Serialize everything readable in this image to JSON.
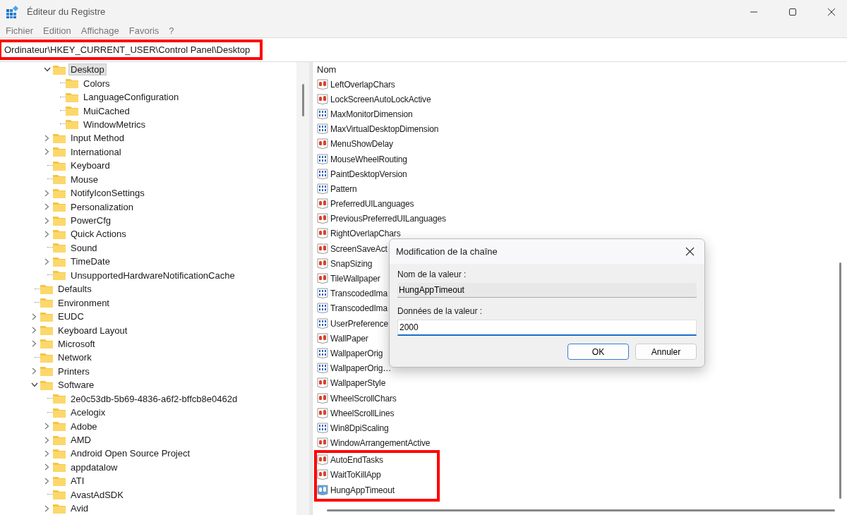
{
  "window": {
    "title": "Éditeur du Registre"
  },
  "menu": [
    "Fichier",
    "Edition",
    "Affichage",
    "Favoris",
    "?"
  ],
  "address_bar": {
    "path": "Ordinateur\\HKEY_CURRENT_USER\\Control Panel\\Desktop",
    "highlighted": true
  },
  "tree": {
    "continued_items": [
      {
        "label": "Desktop",
        "expandable": true,
        "expanded": true,
        "selected": true,
        "children": [
          {
            "label": "Colors",
            "expandable": false,
            "selected": false
          },
          {
            "label": "LanguageConfiguration",
            "expandable": false,
            "selected": false
          },
          {
            "label": "MuiCached",
            "expandable": false,
            "selected": false
          },
          {
            "label": "WindowMetrics",
            "expandable": false,
            "selected": false
          }
        ]
      },
      {
        "label": "Input Method",
        "expandable": true,
        "expanded": false,
        "selected": false
      },
      {
        "label": "International",
        "expandable": true,
        "expanded": false,
        "selected": false
      },
      {
        "label": "Keyboard",
        "expandable": false,
        "selected": false
      },
      {
        "label": "Mouse",
        "expandable": false,
        "selected": false
      },
      {
        "label": "NotifyIconSettings",
        "expandable": true,
        "expanded": false,
        "selected": false
      },
      {
        "label": "Personalization",
        "expandable": true,
        "expanded": false,
        "selected": false
      },
      {
        "label": "PowerCfg",
        "expandable": true,
        "expanded": false,
        "selected": false
      },
      {
        "label": "Quick Actions",
        "expandable": true,
        "expanded": false,
        "selected": false
      },
      {
        "label": "Sound",
        "expandable": false,
        "selected": false
      },
      {
        "label": "TimeDate",
        "expandable": true,
        "expanded": false,
        "selected": false
      },
      {
        "label": "UnsupportedHardwareNotificationCache",
        "expandable": false,
        "selected": false
      }
    ],
    "items": [
      {
        "label": "Defaults",
        "expandable": false,
        "selected": false
      },
      {
        "label": "Environment",
        "expandable": false,
        "selected": false
      },
      {
        "label": "EUDC",
        "expandable": true,
        "expanded": false,
        "selected": false
      },
      {
        "label": "Keyboard Layout",
        "expandable": true,
        "expanded": false,
        "selected": false
      },
      {
        "label": "Microsoft",
        "expandable": true,
        "expanded": false,
        "selected": false
      },
      {
        "label": "Network",
        "expandable": false,
        "selected": false
      },
      {
        "label": "Printers",
        "expandable": true,
        "expanded": false,
        "selected": false
      },
      {
        "label": "Software",
        "expandable": true,
        "expanded": true,
        "selected": false,
        "children": [
          {
            "label": "2e0c53db-5b69-4836-a6f2-bffcb8e0462d",
            "expandable": false,
            "selected": false
          },
          {
            "label": "Acelogix",
            "expandable": false,
            "selected": false
          },
          {
            "label": "Adobe",
            "expandable": true,
            "expanded": false,
            "selected": false
          },
          {
            "label": "AMD",
            "expandable": true,
            "expanded": false,
            "selected": false
          },
          {
            "label": "Android Open Source Project",
            "expandable": true,
            "expanded": false,
            "selected": false
          },
          {
            "label": "appdatalow",
            "expandable": true,
            "expanded": false,
            "selected": false
          },
          {
            "label": "ATI",
            "expandable": true,
            "expanded": false,
            "selected": false
          },
          {
            "label": "AvastAdSDK",
            "expandable": false,
            "selected": false
          },
          {
            "label": "Avid",
            "expandable": true,
            "expanded": false,
            "selected": false
          }
        ]
      }
    ]
  },
  "values": {
    "column": "Nom",
    "items": [
      {
        "name": "LeftOverlapChars",
        "kind": "string",
        "selected": false
      },
      {
        "name": "LockScreenAutoLockActive",
        "kind": "string",
        "selected": false
      },
      {
        "name": "MaxMonitorDimension",
        "kind": "dword",
        "selected": false
      },
      {
        "name": "MaxVirtualDesktopDimension",
        "kind": "dword",
        "selected": false
      },
      {
        "name": "MenuShowDelay",
        "kind": "string",
        "selected": false
      },
      {
        "name": "MouseWheelRouting",
        "kind": "dword",
        "selected": false
      },
      {
        "name": "PaintDesktopVersion",
        "kind": "dword",
        "selected": false
      },
      {
        "name": "Pattern",
        "kind": "dword",
        "selected": false
      },
      {
        "name": "PreferredUILanguages",
        "kind": "string",
        "selected": false
      },
      {
        "name": "PreviousPreferredUILanguages",
        "kind": "string",
        "selected": false
      },
      {
        "name": "RightOverlapChars",
        "kind": "string",
        "selected": false
      },
      {
        "name": "ScreenSaveAct",
        "kind": "string",
        "selected": false
      },
      {
        "name": "SnapSizing",
        "kind": "string",
        "selected": false
      },
      {
        "name": "TileWallpaper",
        "kind": "string",
        "selected": false
      },
      {
        "name": "TranscodedIma",
        "kind": "dword",
        "selected": false
      },
      {
        "name": "TranscodedIma",
        "kind": "dword",
        "selected": false
      },
      {
        "name": "UserPreference",
        "kind": "dword",
        "selected": false
      },
      {
        "name": "WallPaper",
        "kind": "string",
        "selected": false
      },
      {
        "name": "WallpaperOrig",
        "kind": "dword",
        "selected": false
      },
      {
        "name": "WallpaperOrig…",
        "kind": "dword",
        "selected": false
      },
      {
        "name": "WallpaperStyle",
        "kind": "string",
        "selected": false
      },
      {
        "name": "WheelScrollChars",
        "kind": "string",
        "selected": false
      },
      {
        "name": "WheelScrollLines",
        "kind": "string",
        "selected": false
      },
      {
        "name": "Win8DpiScaling",
        "kind": "dword",
        "selected": false
      },
      {
        "name": "WindowArrangementActive",
        "kind": "string",
        "selected": false
      }
    ],
    "highlighted_items": [
      {
        "name": "AutoEndTasks",
        "kind": "string",
        "selected": false
      },
      {
        "name": "WaitToKillApp",
        "kind": "string",
        "selected": false
      },
      {
        "name": "HungAppTimeout",
        "kind": "string",
        "selected": true
      }
    ]
  },
  "dialog": {
    "title": "Modification de la chaîne",
    "name_label": "Nom de la valeur :",
    "name_value": "HungAppTimeout",
    "data_label": "Données de la valeur :",
    "data_value": "2000",
    "buttons": [
      "OK",
      "Annuler"
    ]
  }
}
